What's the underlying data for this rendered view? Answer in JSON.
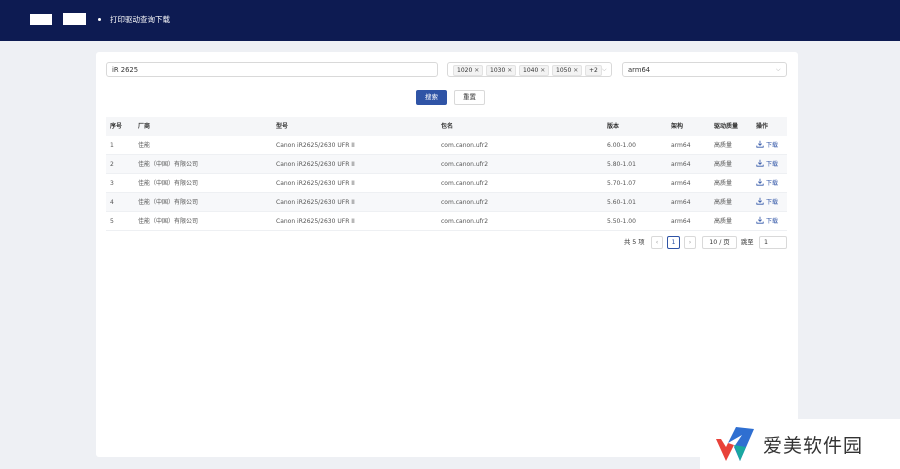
{
  "header": {
    "title": "打印驱动查询下载"
  },
  "filters": {
    "search_value": "iR 2625",
    "tags": [
      "1020",
      "1030",
      "1040",
      "1050"
    ],
    "more_tags": "+2",
    "arch_value": "arm64"
  },
  "buttons": {
    "search": "搜索",
    "reset": "重置"
  },
  "table": {
    "columns": [
      "序号",
      "厂商",
      "型号",
      "包名",
      "版本",
      "架构",
      "驱动质量",
      "操作"
    ],
    "rows": [
      {
        "idx": "1",
        "vendor": "佳能",
        "model": "Canon iR2625/2630 UFR II",
        "pkg": "com.canon.ufr2",
        "version": "6.00-1.00",
        "arch": "arm64",
        "quality": "高质量",
        "action": "下载"
      },
      {
        "idx": "2",
        "vendor": "佳能（中国）有限公司",
        "model": "Canon iR2625/2630 UFR II",
        "pkg": "com.canon.ufr2",
        "version": "5.80-1.01",
        "arch": "arm64",
        "quality": "高质量",
        "action": "下载"
      },
      {
        "idx": "3",
        "vendor": "佳能（中国）有限公司",
        "model": "Canon iR2625/2630 UFR II",
        "pkg": "com.canon.ufr2",
        "version": "5.70-1.07",
        "arch": "arm64",
        "quality": "高质量",
        "action": "下载"
      },
      {
        "idx": "4",
        "vendor": "佳能（中国）有限公司",
        "model": "Canon iR2625/2630 UFR II",
        "pkg": "com.canon.ufr2",
        "version": "5.60-1.01",
        "arch": "arm64",
        "quality": "高质量",
        "action": "下载"
      },
      {
        "idx": "5",
        "vendor": "佳能（中国）有限公司",
        "model": "Canon iR2625/2630 UFR II",
        "pkg": "com.canon.ufr2",
        "version": "5.50-1.00",
        "arch": "arm64",
        "quality": "高质量",
        "action": "下载"
      }
    ]
  },
  "pagination": {
    "total": "共 5 项",
    "current_page": "1",
    "page_size": "10 / 页",
    "jump_label": "跳至",
    "jump_value": "1"
  },
  "watermark": {
    "text": "爱美软件园"
  },
  "colors": {
    "header_bg": "#0d1b52",
    "primary": "#2f54a6"
  }
}
